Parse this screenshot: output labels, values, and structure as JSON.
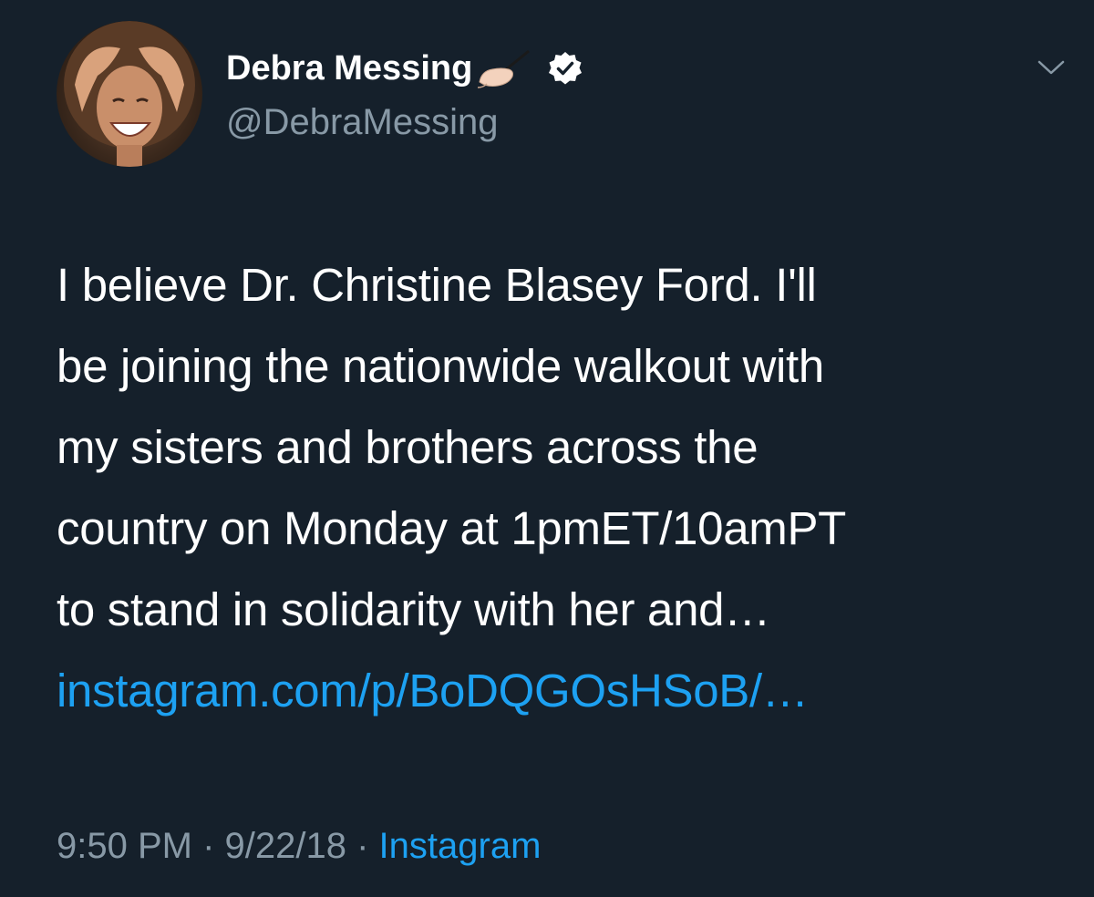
{
  "author": {
    "display_name": "Debra Messing",
    "handle": "@DebraMessing",
    "name_emoji": "writing-hand-emoji",
    "verified_badge": "verified-icon"
  },
  "tweet": {
    "lines": [
      "I believe Dr. Christine Blasey Ford. I'll",
      "be joining the nationwide walkout with",
      "my sisters and brothers across the",
      "country on Monday at 1pmET/10amPT",
      "to stand in solidarity with her and…"
    ],
    "link_text": "instagram.com/p/BoDQGOsHSoB/…"
  },
  "meta": {
    "time": "9:50 PM",
    "separator1": " · ",
    "date": "9/22/18",
    "separator2": " · ",
    "source": "Instagram"
  },
  "icons": {
    "menu": "chevron-down-icon"
  },
  "colors": {
    "background": "#15202b",
    "text": "#ffffff",
    "secondary": "#8899a6",
    "link": "#1da1f2"
  }
}
